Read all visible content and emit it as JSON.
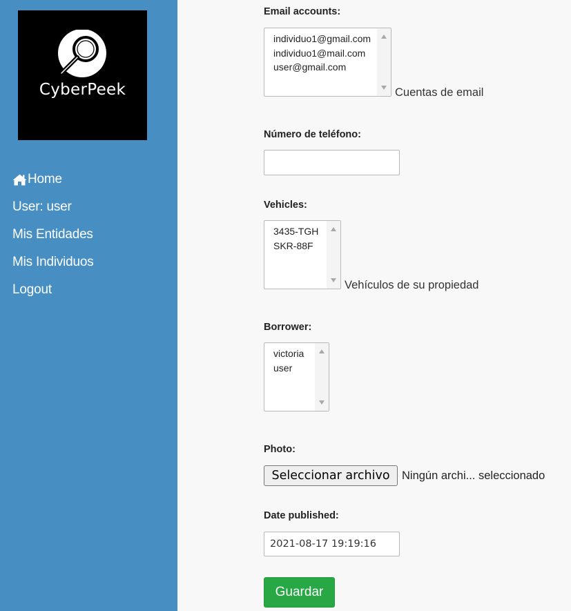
{
  "brand": {
    "logo_text": "CyberPeek"
  },
  "sidebar": {
    "items": [
      {
        "label": "Home",
        "icon": "home-icon"
      },
      {
        "label": "User: user"
      },
      {
        "label": "Mis Entidades"
      },
      {
        "label": "Mis Individuos"
      },
      {
        "label": "Logout"
      }
    ]
  },
  "form": {
    "email": {
      "label": "Email accounts:",
      "options": [
        "individuo1@gmail.com",
        "individuo1@mail.com",
        "user@gmail.com"
      ],
      "help": "Cuentas de email"
    },
    "phone": {
      "label": "Número de teléfono:",
      "value": ""
    },
    "vehicles": {
      "label": "Vehicles:",
      "options": [
        "3435-TGH",
        "SKR-88F"
      ],
      "help": "Vehículos de su propiedad"
    },
    "borrower": {
      "label": "Borrower:",
      "options": [
        "victoria",
        "user"
      ]
    },
    "photo": {
      "label": "Photo:",
      "button": "Seleccionar archivo",
      "status": "Ningún archi... seleccionado"
    },
    "date": {
      "label": "Date published:",
      "value": "2021-08-17 19:19:16"
    },
    "submit": "Guardar"
  },
  "colors": {
    "sidebar": "#478fc2",
    "save_button": "#28a745",
    "background": "#f8f8f8"
  }
}
